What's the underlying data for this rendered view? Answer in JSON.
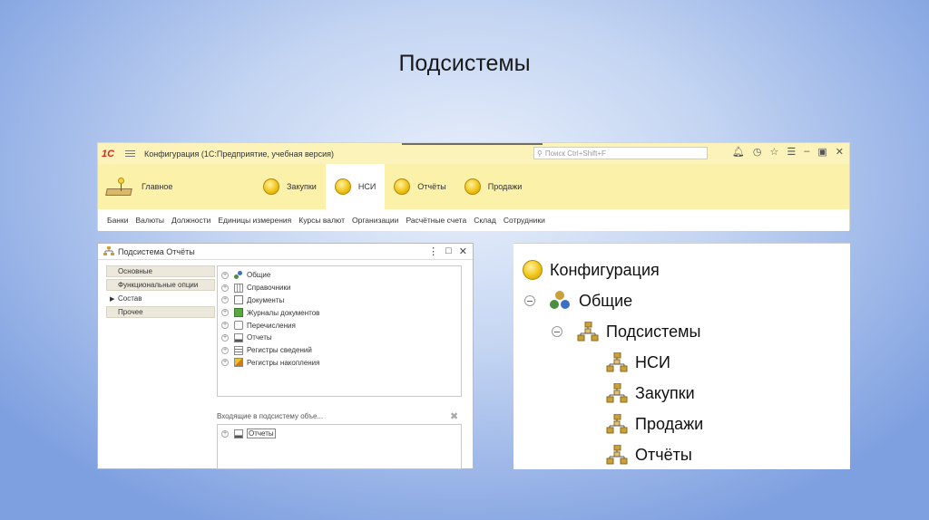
{
  "slide_title": "Подсистемы",
  "app": {
    "logo": "1С",
    "title": "Конфигурация  (1С:Предприятие, учебная версия)",
    "search_placeholder": "Поиск Ctrl+Shift+F",
    "sections": [
      {
        "label": "Главное",
        "active": false
      },
      {
        "label": "Закупки",
        "active": false
      },
      {
        "label": "НСИ",
        "active": true
      },
      {
        "label": "Отчёты",
        "active": false
      },
      {
        "label": "Продажи",
        "active": false
      }
    ],
    "subnav": [
      "Банки",
      "Валюты",
      "Должности",
      "Единицы измерения",
      "Курсы валют",
      "Организации",
      "Расчётные счета",
      "Склад",
      "Сотрудники"
    ]
  },
  "dialog": {
    "title": "Подсистема Отчёты",
    "tabs": [
      {
        "label": "Основные"
      },
      {
        "label": "Функциональные опции"
      },
      {
        "label": "Состав",
        "selected": true
      },
      {
        "label": "Прочее"
      }
    ],
    "tree": [
      "Общие",
      "Справочники",
      "Документы",
      "Журналы документов",
      "Перечисления",
      "Отчеты",
      "Регистры сведений",
      "Регистры накопления"
    ],
    "included_label": "Входящие в подсистему объе...",
    "included": [
      "Отчеты"
    ]
  },
  "config_tree": {
    "root": "Конфигурация",
    "common": "Общие",
    "subsystems": "Подсистемы",
    "items": [
      "НСИ",
      "Закупки",
      "Продажи",
      "Отчёты"
    ]
  }
}
